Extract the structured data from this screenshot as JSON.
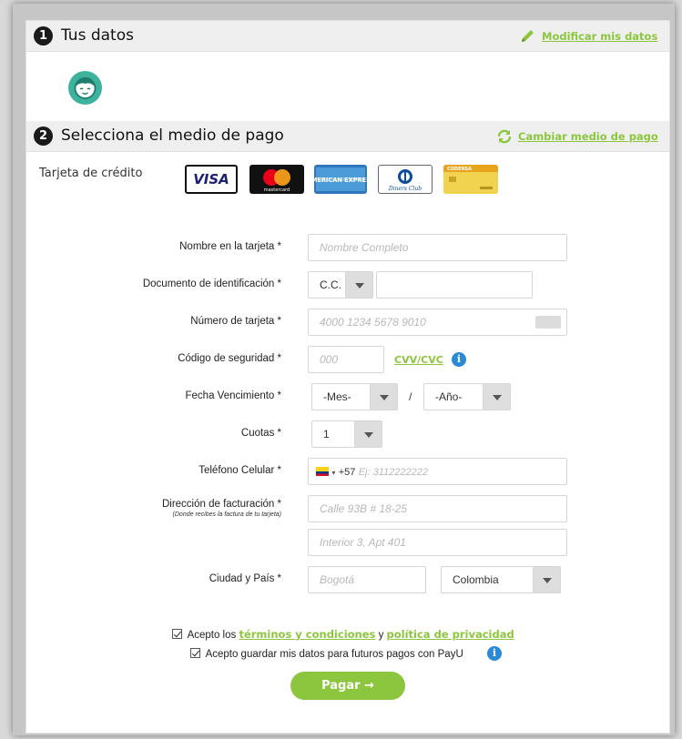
{
  "section1": {
    "number": "1",
    "title": "Tus datos",
    "action": "Modificar mis datos"
  },
  "section2": {
    "number": "2",
    "title": "Selecciona el medio de pago",
    "action": "Cambiar medio de pago"
  },
  "payment_method": {
    "label": "Tarjeta de crédito",
    "cards": [
      {
        "name": "VISA"
      },
      {
        "name": "mastercard"
      },
      {
        "name": "AMERICAN EXPRESS"
      },
      {
        "name": "Diners Club"
      },
      {
        "name": "CODENSA"
      }
    ]
  },
  "form": {
    "name_label": "Nombre en la tarjeta *",
    "name_placeholder": "Nombre Completo",
    "doc_label": "Documento de identificación *",
    "doc_type": "C.C.",
    "card_number_label": "Número de tarjeta *",
    "card_number_placeholder": "4000 1234 5678 9010",
    "security_label": "Código de seguridad *",
    "security_placeholder": "000",
    "cvv_link": "CVV/CVC",
    "expiry_label": "Fecha Vencimiento *",
    "month": "-Mes-",
    "slash": "/",
    "year": "-Año-",
    "installments_label": "Cuotas *",
    "installments_value": "1",
    "phone_label": "Teléfono Celular *",
    "phone_prefix": "+57",
    "phone_placeholder": "Ej: 3112222222",
    "address_label": "Dirección de facturación *",
    "address_sublabel": "(Donde recibes la factura de tu tarjeta)",
    "address_placeholder": "Calle 93B # 18-25",
    "address2_placeholder": "Interior 3, Apt 401",
    "city_label": "Ciudad y País *",
    "city_placeholder": "Bogotá",
    "country": "Colombia"
  },
  "consent": {
    "terms_prefix": "Acepto los",
    "terms_link": "términos y condiciones",
    "terms_joiner": "y",
    "privacy_link": "política de privacidad",
    "save_data": "Acepto guardar mis datos para futuros pagos con PayU"
  },
  "pay_button": "Pagar →",
  "colors": {
    "accent": "#8cc63f",
    "info": "#2b8ad6",
    "avatar": "#3db39e"
  }
}
